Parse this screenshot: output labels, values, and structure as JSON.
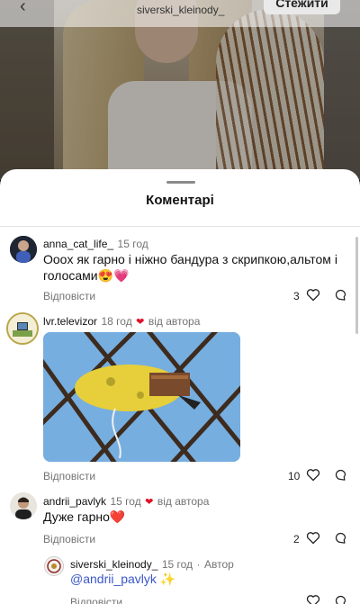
{
  "header": {
    "username": "siverski_kleinody_",
    "follow_label": "Стежити",
    "back_icon": "chevron-left-icon"
  },
  "sheet": {
    "title": "Коментарі"
  },
  "comments": [
    {
      "username": "anna_cat_life_",
      "time": "15 год",
      "text": "Оооx як гарно і ніжно бандура з скрипкою,альтом і голосами😍💗",
      "reply": "Відповісти",
      "likes": "3"
    },
    {
      "username": "lvr.televizor",
      "time": "18 год",
      "badge": "від автора",
      "reply": "Відповісти",
      "likes": "10"
    },
    {
      "username": "andrii_pavlyk",
      "time": "15 год",
      "badge": "від автора",
      "text": "Дуже гарно❤️",
      "reply": "Відповісти",
      "likes": "2"
    }
  ],
  "nested_reply": {
    "username": "siverski_kleinody_",
    "time": "15 год",
    "role": "Автор",
    "mention": "@andrii_pavlyk",
    "sparkle": "✨",
    "reply": "Відповісти"
  },
  "colors": {
    "heart": "#e0122a",
    "mention": "#3a57c9",
    "meta": "#737373"
  }
}
